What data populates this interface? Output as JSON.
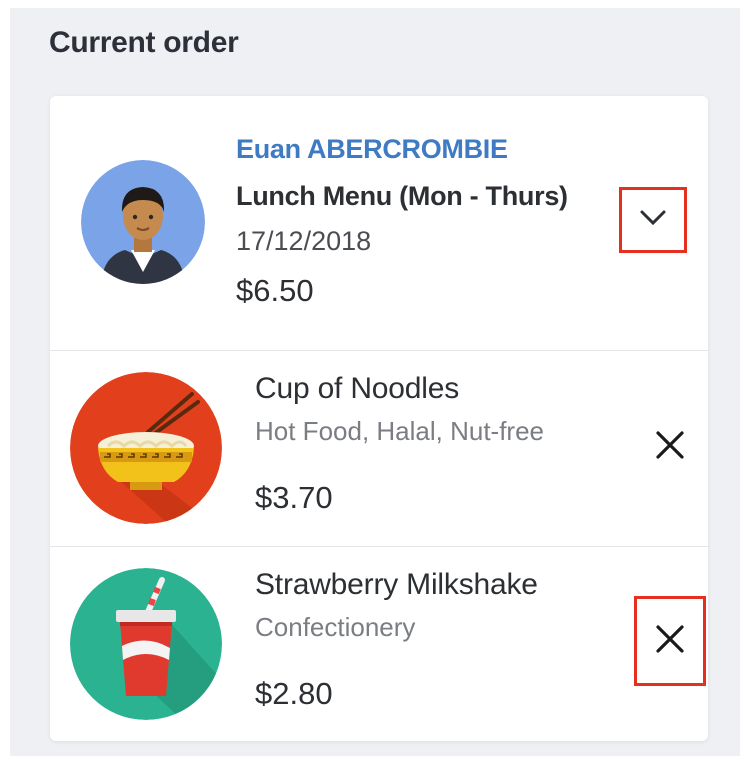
{
  "section_title": "Current order",
  "order": {
    "customer_name": "Euan ABERCROMBIE",
    "menu_name": "Lunch Menu (Mon - Thurs)",
    "date": "17/12/2018",
    "total": "$6.50",
    "avatar_icon": "person-avatar-icon",
    "expand_icon": "chevron-down-icon"
  },
  "items": [
    {
      "name": "Cup of Noodles",
      "tags": "Hot Food, Halal, Nut-free",
      "price": "$3.70",
      "icon": "noodle-bowl-icon",
      "remove_icon": "close-icon"
    },
    {
      "name": "Strawberry Milkshake",
      "tags": "Confectionery",
      "price": "$2.80",
      "icon": "milkshake-cup-icon",
      "remove_icon": "close-icon"
    }
  ],
  "colors": {
    "accent_blue": "#3f7bc3",
    "highlight_red": "#e5301f",
    "noodle_bg": "#e2401c",
    "milkshake_bg": "#2bb391",
    "avatar_bg": "#7aa3e8"
  }
}
